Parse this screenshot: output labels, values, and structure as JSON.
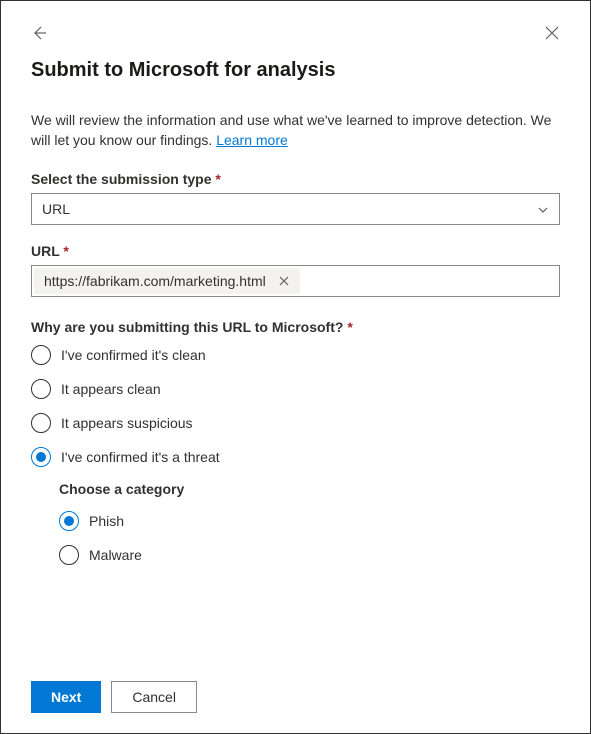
{
  "header": {
    "title": "Submit to Microsoft for analysis"
  },
  "description": {
    "text": "We will review the information and use what we've learned to improve detection. We will let you know our findings. ",
    "link": "Learn more"
  },
  "fields": {
    "submission_type": {
      "label": "Select the submission type",
      "required": "*",
      "value": "URL"
    },
    "url": {
      "label": "URL",
      "required": "*",
      "chip_value": "https://fabrikam.com/marketing.html"
    },
    "reason": {
      "label": "Why are you submitting this URL to Microsoft?",
      "required": "*",
      "options": [
        {
          "label": "I've confirmed it's clean",
          "selected": false
        },
        {
          "label": "It appears clean",
          "selected": false
        },
        {
          "label": "It appears suspicious",
          "selected": false
        },
        {
          "label": "I've confirmed it's a threat",
          "selected": true
        }
      ]
    },
    "category": {
      "label": "Choose a category",
      "options": [
        {
          "label": "Phish",
          "selected": true
        },
        {
          "label": "Malware",
          "selected": false
        }
      ]
    }
  },
  "buttons": {
    "next": "Next",
    "cancel": "Cancel"
  }
}
